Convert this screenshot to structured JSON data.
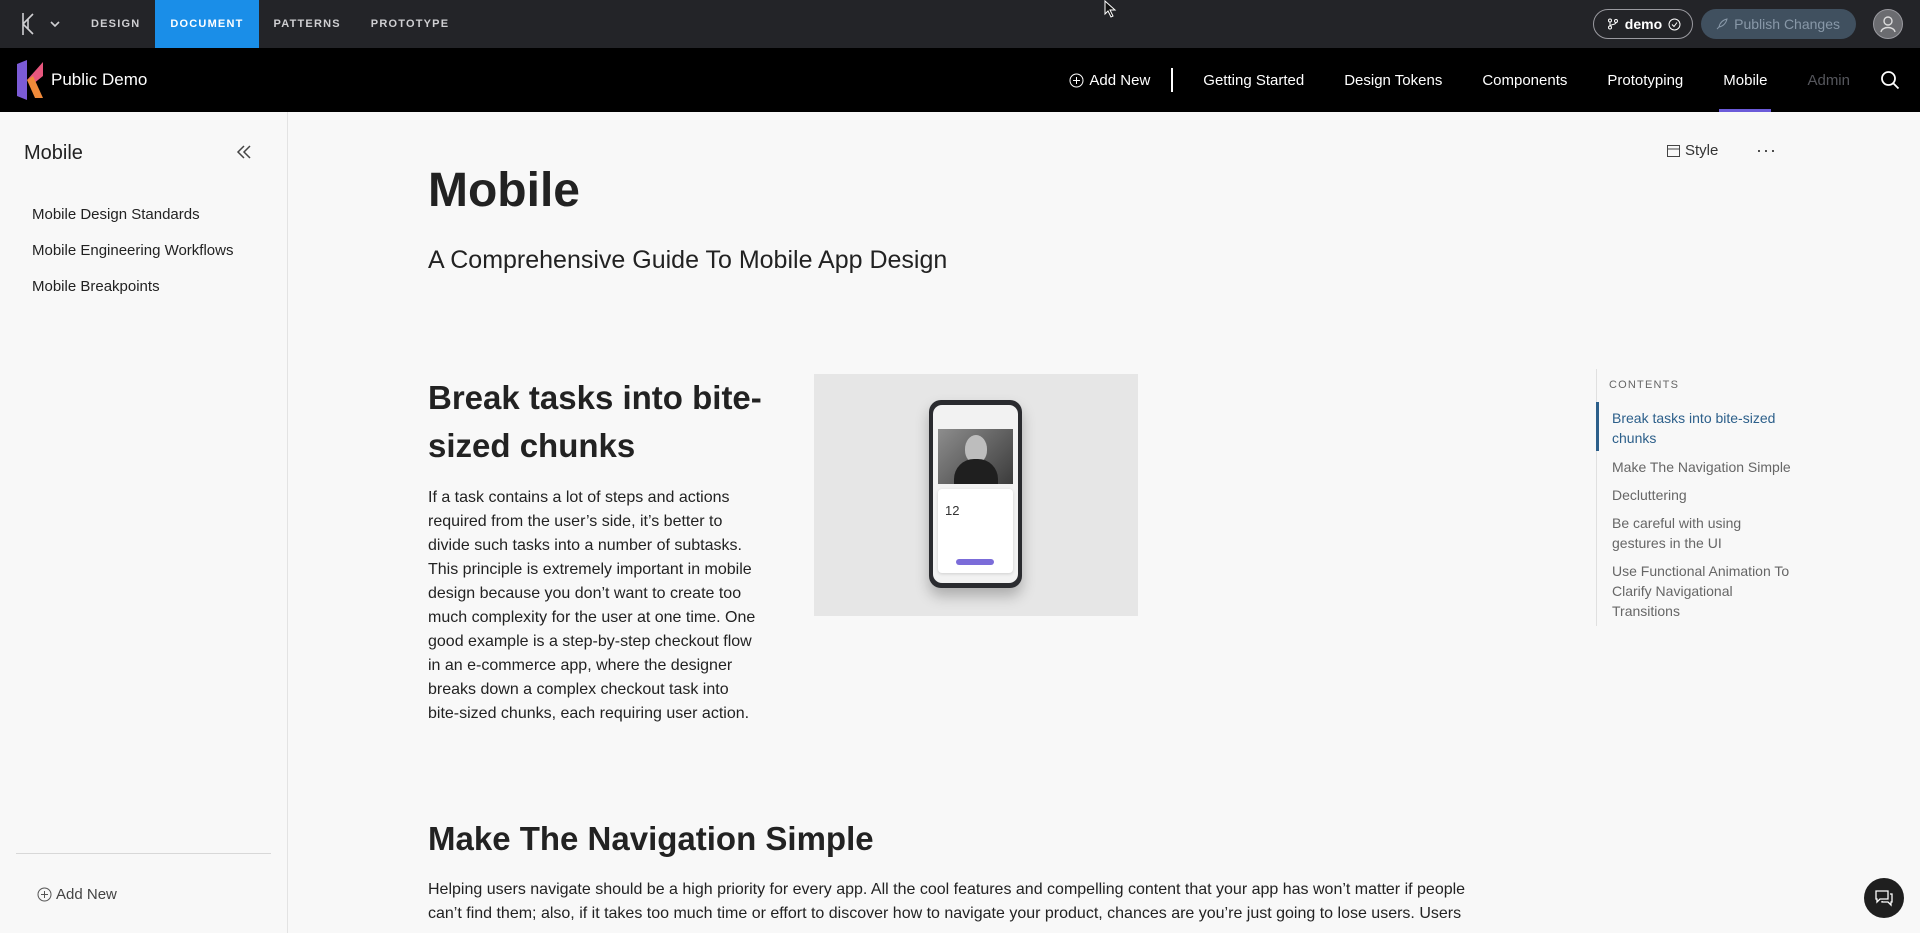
{
  "toolbar": {
    "modes": [
      {
        "label": "DESIGN",
        "active": false
      },
      {
        "label": "DOCUMENT",
        "active": true
      },
      {
        "label": "PATTERNS",
        "active": false
      },
      {
        "label": "PROTOTYPE",
        "active": false
      }
    ],
    "branch": "demo",
    "publish_label": "Publish Changes",
    "accent": "#1a8ee8"
  },
  "header": {
    "site_name": "Public Demo",
    "add_new": "Add New",
    "nav": [
      "Getting Started",
      "Design Tokens",
      "Components",
      "Prototyping",
      "Mobile",
      "Admin"
    ],
    "active_nav": "Mobile",
    "accent": "#6b5bd9"
  },
  "sidebar": {
    "title": "Mobile",
    "items": [
      "Mobile Design Standards",
      "Mobile Engineering Workflows",
      "Mobile Breakpoints"
    ],
    "add_new": "Add New"
  },
  "page": {
    "style_label": "Style",
    "more_label": "···",
    "title": "Mobile",
    "subtitle": "A Comprehensive Guide To Mobile App Design",
    "sections": [
      {
        "heading": "Break tasks into bite-sized chunks",
        "body": "If a task contains a lot of steps and actions required from the user’s side, it’s better to divide such tasks into a number of subtasks. This principle is extremely important in mobile design because you don’t want to create too much complexity for the user at one time. One good example is a step-by-step checkout flow in an e-commerce app, where the designer breaks down a complex checkout task into bite-sized chunks, each requiring user action."
      },
      {
        "heading": "Make The Navigation Simple",
        "body": "Helping users navigate should be a high priority for every app. All the cool features and compelling content that your app has won’t matter if people can’t find them; also, if it takes too much time or effort to discover how to navigate your product, chances are you’re just going to lose users. Users"
      }
    ],
    "figure_number": "12"
  },
  "toc": {
    "heading": "CONTENTS",
    "items": [
      "Break tasks into bite-sized chunks",
      "Make The Navigation Simple",
      "Decluttering",
      "Be careful with using gestures in the UI",
      "Use Functional Animation To Clarify Navigational Transitions"
    ],
    "active_index": 0,
    "accent": "#2c5f8a"
  }
}
